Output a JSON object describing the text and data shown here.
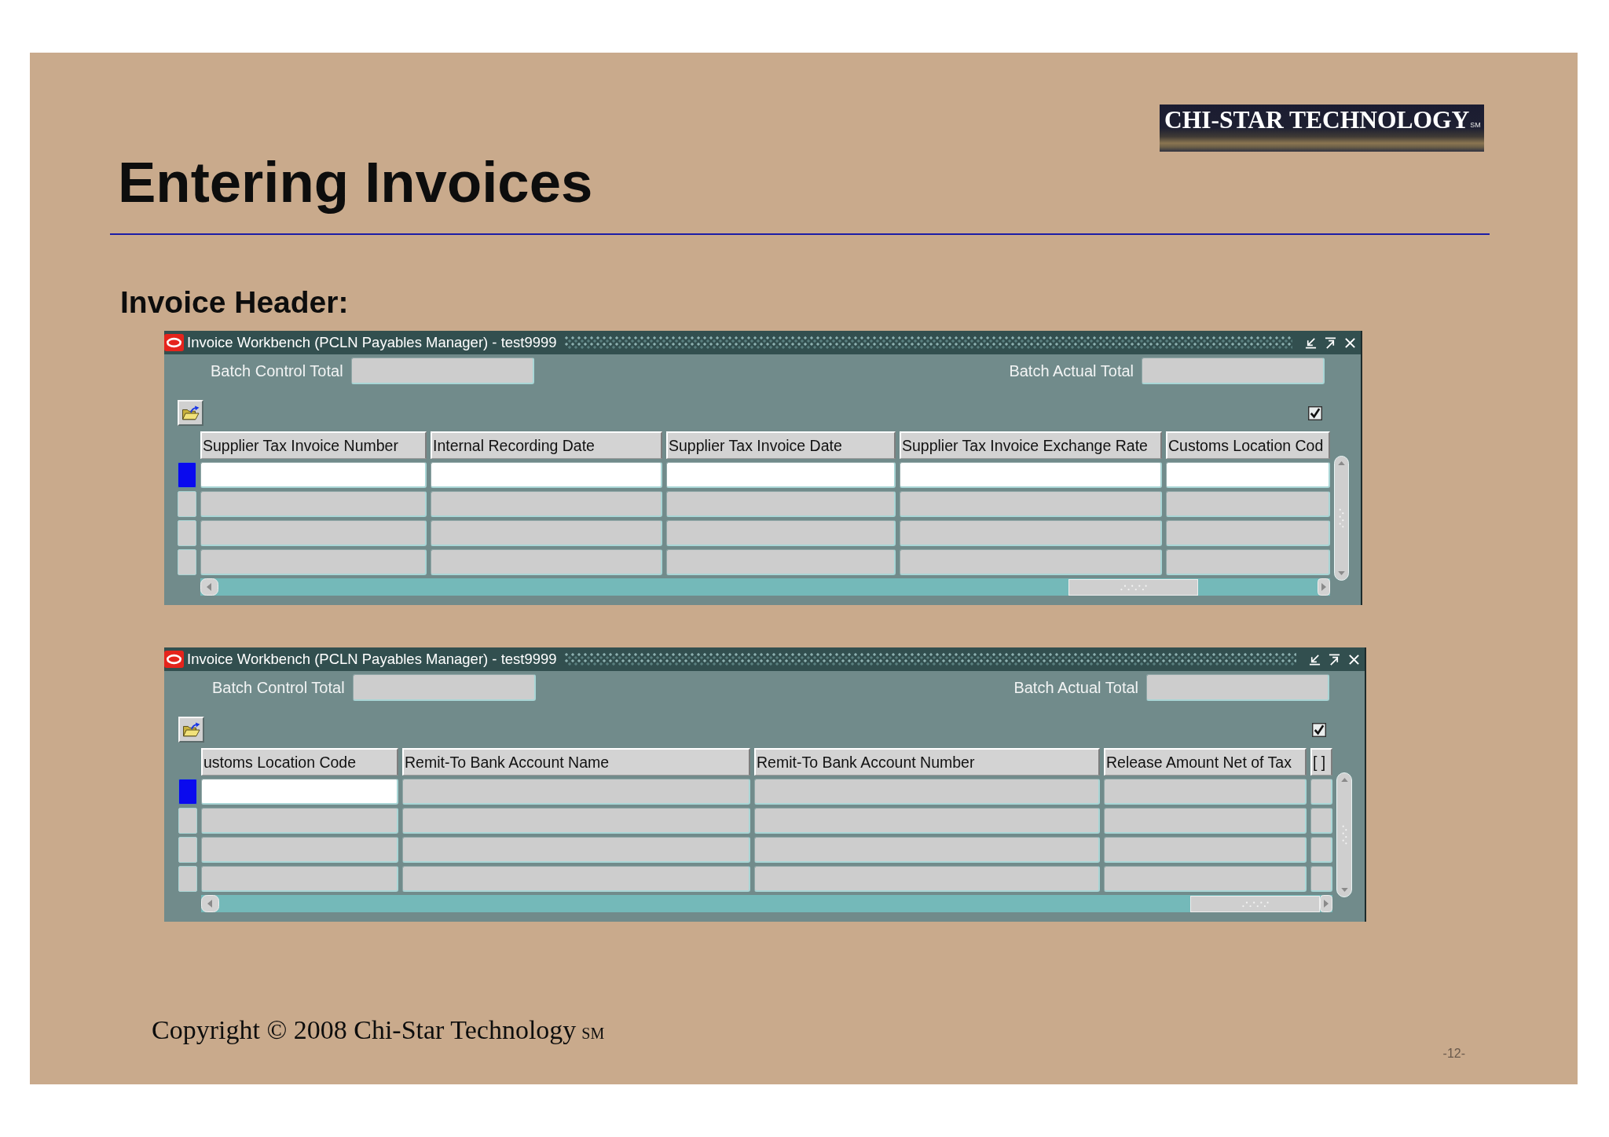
{
  "slide": {
    "title": "Entering Invoices",
    "logo": {
      "text": "CHI-STAR TECHNOLOGY",
      "mark": "SM"
    },
    "section_heading": "Invoice Header:"
  },
  "windows": [
    {
      "title": "Invoice Workbench (PCLN Payables Manager) - test9999",
      "fields": [
        {
          "label": "Batch Control Total"
        },
        {
          "label": "Batch Actual Total"
        }
      ],
      "checkbox": {
        "checked": true
      },
      "table": {
        "columns": [
          {
            "label": "Supplier Tax Invoice Number",
            "editable": true
          },
          {
            "label": "Internal Recording Date",
            "editable": true
          },
          {
            "label": "Supplier Tax Invoice Date",
            "editable": true
          },
          {
            "label": "Supplier Tax Invoice Exchange Rate",
            "editable": true
          },
          {
            "label": "Customs Location Cod",
            "editable": true
          }
        ],
        "rows": [
          {
            "selected": true
          },
          {
            "selected": false
          },
          {
            "selected": false
          },
          {
            "selected": false
          }
        ]
      }
    },
    {
      "title": "Invoice Workbench (PCLN Payables Manager) - test9999",
      "fields": [
        {
          "label": "Batch Control Total"
        },
        {
          "label": "Batch Actual Total"
        }
      ],
      "checkbox": {
        "checked": true
      },
      "table": {
        "columns": [
          {
            "label": "ustoms Location Code",
            "editable": true
          },
          {
            "label": "Remit-To Bank Account Name",
            "editable": false
          },
          {
            "label": "Remit-To Bank Account Number",
            "editable": false
          },
          {
            "label": "Release Amount Net of Tax",
            "editable": false
          },
          {
            "label": "[ ]",
            "editable": false
          }
        ],
        "rows": [
          {
            "selected": true
          },
          {
            "selected": false
          },
          {
            "selected": false
          },
          {
            "selected": false
          }
        ]
      }
    }
  ],
  "footer": {
    "copyright": "Copyright © 2008 Chi-Star Technology",
    "mark": "SM",
    "page_number": "-12-"
  }
}
